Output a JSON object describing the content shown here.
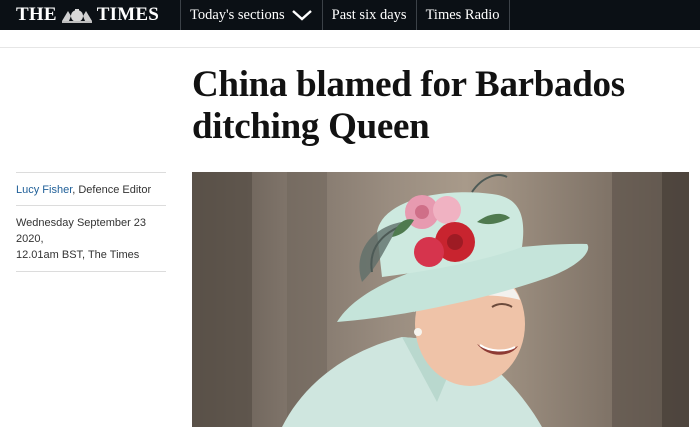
{
  "header": {
    "logo_left": "THE",
    "logo_right": "TIMES",
    "nav": [
      {
        "label": "Today's sections",
        "icon": "chevron-down-icon"
      },
      {
        "label": "Past six days"
      },
      {
        "label": "Times Radio"
      }
    ]
  },
  "article": {
    "headline_line1": "China blamed for Barbados",
    "headline_line2": "ditching Queen",
    "author": "Lucy Fisher",
    "author_role": ", Defence Editor",
    "date_line1": "Wednesday September 23 2020,",
    "date_line2": "12.01am BST, The Times"
  },
  "colors": {
    "nav_background": "#0b1015",
    "author_link": "#1f5f98",
    "hat": "#c5e4da"
  }
}
